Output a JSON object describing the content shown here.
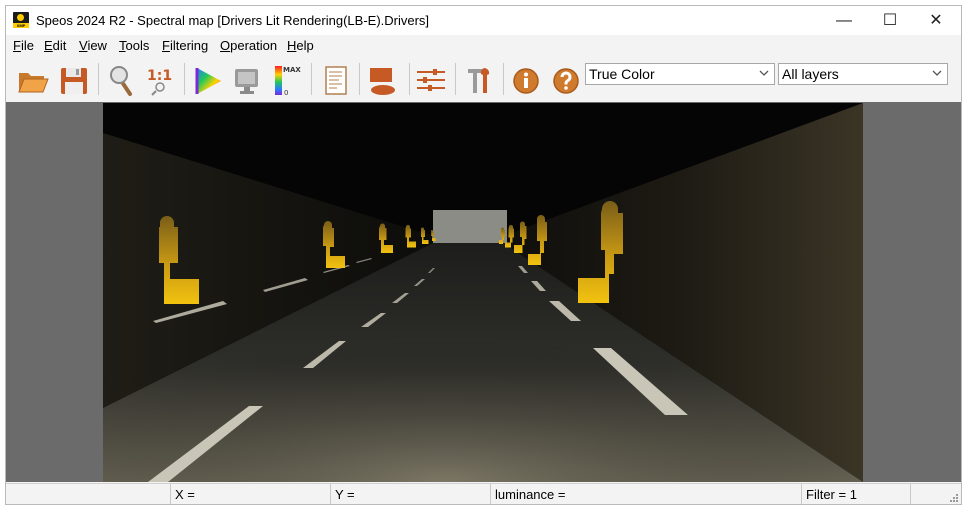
{
  "window": {
    "title": "Speos 2024 R2 - Spectral map [Drivers Lit Rendering(LB-E).Drivers]",
    "app_icon_text": "XMP",
    "controls": {
      "minimize": "—",
      "maximize": "☐",
      "close": "✕"
    }
  },
  "menu": {
    "items": [
      {
        "key": "F",
        "rest": "ile"
      },
      {
        "key": "E",
        "rest": "dit"
      },
      {
        "key": "V",
        "rest": "iew"
      },
      {
        "key": "T",
        "rest": "ools"
      },
      {
        "key": "F",
        "rest": "iltering"
      },
      {
        "key": "O",
        "rest": "peration"
      },
      {
        "key": "H",
        "rest": "elp"
      }
    ]
  },
  "toolbar": {
    "buttons": [
      "open-folder-icon",
      "save-icon",
      "zoom-icon",
      "actual-size-icon",
      "color-gamut-icon",
      "monitor-icon",
      "false-color-scale-icon",
      "report-icon",
      "surface-icon",
      "settings-sliders-icon",
      "tools-icon",
      "info-icon",
      "help-icon"
    ],
    "actual_size_label": "1:1",
    "scale_max_label": "MAX",
    "scale_min_label": "0",
    "color_mode": {
      "selected": "True Color"
    },
    "layers": {
      "selected": "All layers"
    }
  },
  "status": {
    "x_label": "X =",
    "y_label": "Y =",
    "luminance_label": "luminance =",
    "filter_label": "Filter = 1"
  },
  "colors": {
    "accent_wood": "#d07a2e",
    "figure_yellow": "#f2c20f"
  }
}
